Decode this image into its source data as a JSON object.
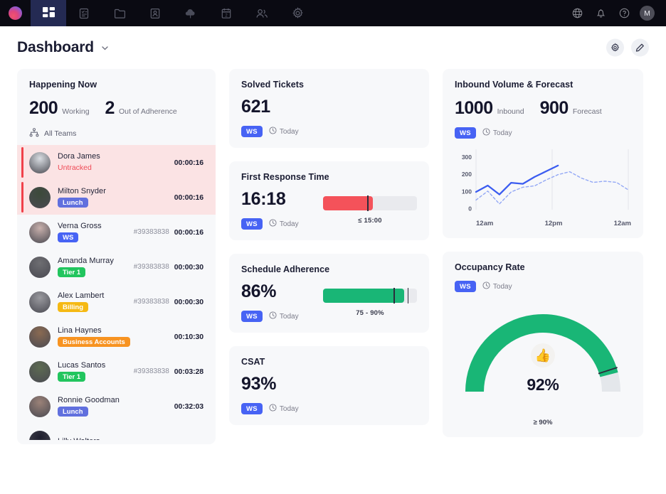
{
  "topnav": {
    "logo_icon": "app-logo",
    "items": [
      {
        "icon": "dashboard-grid-icon",
        "active": true
      },
      {
        "icon": "tasks-list-icon",
        "active": false
      },
      {
        "icon": "folder-icon",
        "active": false
      },
      {
        "icon": "contact-card-icon",
        "active": false
      },
      {
        "icon": "cloud-icon",
        "active": false
      },
      {
        "icon": "calendar-icon",
        "active": false
      },
      {
        "icon": "people-icon",
        "active": false
      },
      {
        "icon": "gear-icon",
        "active": false
      }
    ],
    "right": [
      {
        "icon": "globe-icon"
      },
      {
        "icon": "bell-icon"
      },
      {
        "icon": "help-icon"
      }
    ],
    "avatar_initial": "M"
  },
  "header": {
    "title": "Dashboard",
    "caret_icon": "chevron-down-icon",
    "actions": [
      {
        "icon": "settings-gear-icon"
      },
      {
        "icon": "edit-pencil-icon"
      }
    ]
  },
  "happening_now": {
    "title": "Happening Now",
    "metrics": [
      {
        "value": "200",
        "label": "Working"
      },
      {
        "value": "2",
        "label": "Out of Adherence"
      }
    ],
    "team_filter": {
      "icon": "org-chart-icon",
      "label": "All Teams"
    },
    "agents": [
      {
        "name": "Dora James",
        "status": "Untracked",
        "status_type": "plain",
        "status_color": "#ef4a56",
        "ticket": "",
        "timer": "00:00:16",
        "alert": true,
        "avatar_color": "#d9dde2"
      },
      {
        "name": "Milton Snyder",
        "status": "Lunch",
        "status_type": "badge",
        "status_color": "#6170de",
        "ticket": "",
        "timer": "00:00:16",
        "alert": true,
        "avatar_color": "#3c4a3a"
      },
      {
        "name": "Verna Gross",
        "status": "WS",
        "status_type": "badge",
        "status_color": "#4763f4",
        "ticket": "#39383838",
        "timer": "00:00:16",
        "alert": false,
        "avatar_color": "#c8b0ac"
      },
      {
        "name": "Amanda Murray",
        "status": "Tier 1",
        "status_type": "badge",
        "status_color": "#22c55e",
        "ticket": "#39383838",
        "timer": "00:00:30",
        "alert": false,
        "avatar_color": "#6e6e72"
      },
      {
        "name": "Alex Lambert",
        "status": "Billing",
        "status_type": "badge",
        "status_color": "#f5b914",
        "ticket": "#39383838",
        "timer": "00:00:30",
        "alert": false,
        "avatar_color": "#9a9a9f"
      },
      {
        "name": "Lina Haynes",
        "status": "Business Accounts",
        "status_type": "badge",
        "status_color": "#f79321",
        "ticket": "",
        "timer": "00:10:30",
        "alert": false,
        "avatar_color": "#8a6a52"
      },
      {
        "name": "Lucas Santos",
        "status": "Tier 1",
        "status_type": "badge",
        "status_color": "#22c55e",
        "ticket": "#39383838",
        "timer": "00:03:28",
        "alert": false,
        "avatar_color": "#5d6b52"
      },
      {
        "name": "Ronnie Goodman",
        "status": "Lunch",
        "status_type": "badge",
        "status_color": "#6170de",
        "ticket": "",
        "timer": "00:32:03",
        "alert": false,
        "avatar_color": "#9b8278"
      },
      {
        "name": "Lilly Walters",
        "status": "",
        "status_type": "none",
        "status_color": "",
        "ticket": "",
        "timer": "",
        "alert": false,
        "avatar_color": "#1e1e2e"
      }
    ]
  },
  "solved_tickets": {
    "title": "Solved Tickets",
    "value": "621",
    "badge": "WS",
    "period": "Today",
    "clock_icon": "clock-icon"
  },
  "first_response_time": {
    "title": "First Response Time",
    "value": "16:18",
    "badge": "WS",
    "period": "Today",
    "clock_icon": "clock-icon",
    "bar": {
      "fill_pct": 53,
      "tick_pct": 47,
      "color": "#f4525a",
      "caption": "≤ 15:00"
    }
  },
  "schedule_adherence": {
    "title": "Schedule Adherence",
    "value": "86%",
    "badge": "WS",
    "period": "Today",
    "clock_icon": "clock-icon",
    "bar": {
      "fill_pct": 86,
      "tick_pct": 75,
      "tick2_pct": 90,
      "color": "#19b676",
      "caption": "75 - 90%"
    }
  },
  "csat": {
    "title": "CSAT",
    "value": "93%",
    "badge": "WS",
    "period": "Today",
    "clock_icon": "clock-icon"
  },
  "inbound_volume": {
    "title": "Inbound Volume & Forecast",
    "metrics": [
      {
        "value": "1000",
        "label": "Inbound"
      },
      {
        "value": "900",
        "label": "Forecast"
      }
    ],
    "badge": "WS",
    "period": "Today",
    "clock_icon": "clock-icon"
  },
  "occupancy_rate": {
    "title": "Occupancy Rate",
    "badge": "WS",
    "period": "Today",
    "clock_icon": "clock-icon",
    "value": "92%",
    "caption": "≥ 90%",
    "thumb_icon": "thumbs-up-icon",
    "gauge_pct": 92,
    "gauge_color": "#19b676",
    "gauge_track": "#e4e7eb"
  },
  "chart_data": {
    "type": "line",
    "title": "Inbound Volume & Forecast",
    "xlabel": "",
    "ylabel": "",
    "ylim": [
      0,
      330
    ],
    "yticks": [
      0,
      100,
      200,
      300
    ],
    "xticks": [
      "12am",
      "12pm",
      "12am"
    ],
    "grid": "vertical",
    "legend": "none",
    "series": [
      {
        "name": "Inbound",
        "style": "solid",
        "color": "#3b5cf0",
        "x": [
          0,
          1,
          2,
          3,
          4,
          5,
          6,
          7
        ],
        "values": [
          95,
          132,
          80,
          148,
          142,
          182,
          215,
          248
        ]
      },
      {
        "name": "Forecast",
        "style": "dashed",
        "color": "#93a8f5",
        "x": [
          0,
          1,
          2,
          3,
          4,
          5,
          6,
          7,
          8,
          9,
          10,
          11,
          12,
          13
        ],
        "values": [
          48,
          100,
          25,
          95,
          122,
          130,
          165,
          195,
          212,
          175,
          150,
          157,
          150,
          107
        ]
      }
    ]
  }
}
